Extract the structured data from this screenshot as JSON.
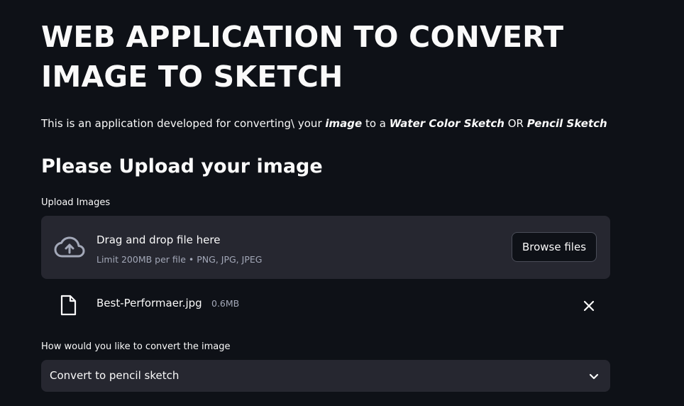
{
  "title": "WEB APPLICATION TO CONVERT IMAGE TO SKETCH",
  "intro": {
    "part1": "This is an application developed for converting\\ your ",
    "em1": "image",
    "part2": " to a ",
    "em2": "Water Color Sketch",
    "part3": " OR ",
    "em3": "Pencil Sketch"
  },
  "subheader": "Please Upload your image",
  "uploader": {
    "label": "Upload Images",
    "drop_text": "Drag and drop file here",
    "limit_text": "Limit 200MB per file • PNG, JPG, JPEG",
    "browse_label": "Browse files",
    "icon": "cloud-upload-icon"
  },
  "uploaded_file": {
    "name": "Best-Performaer.jpg",
    "size": "0.6MB",
    "icon": "file-icon",
    "remove_icon": "close-icon"
  },
  "convert": {
    "label": "How would you like to convert the image",
    "selected": "Convert to pencil sketch",
    "icon": "chevron-down-icon"
  },
  "colors": {
    "background": "#0e1117",
    "surface": "#262730",
    "text": "#fafafa",
    "muted": "#a3a8b8"
  }
}
